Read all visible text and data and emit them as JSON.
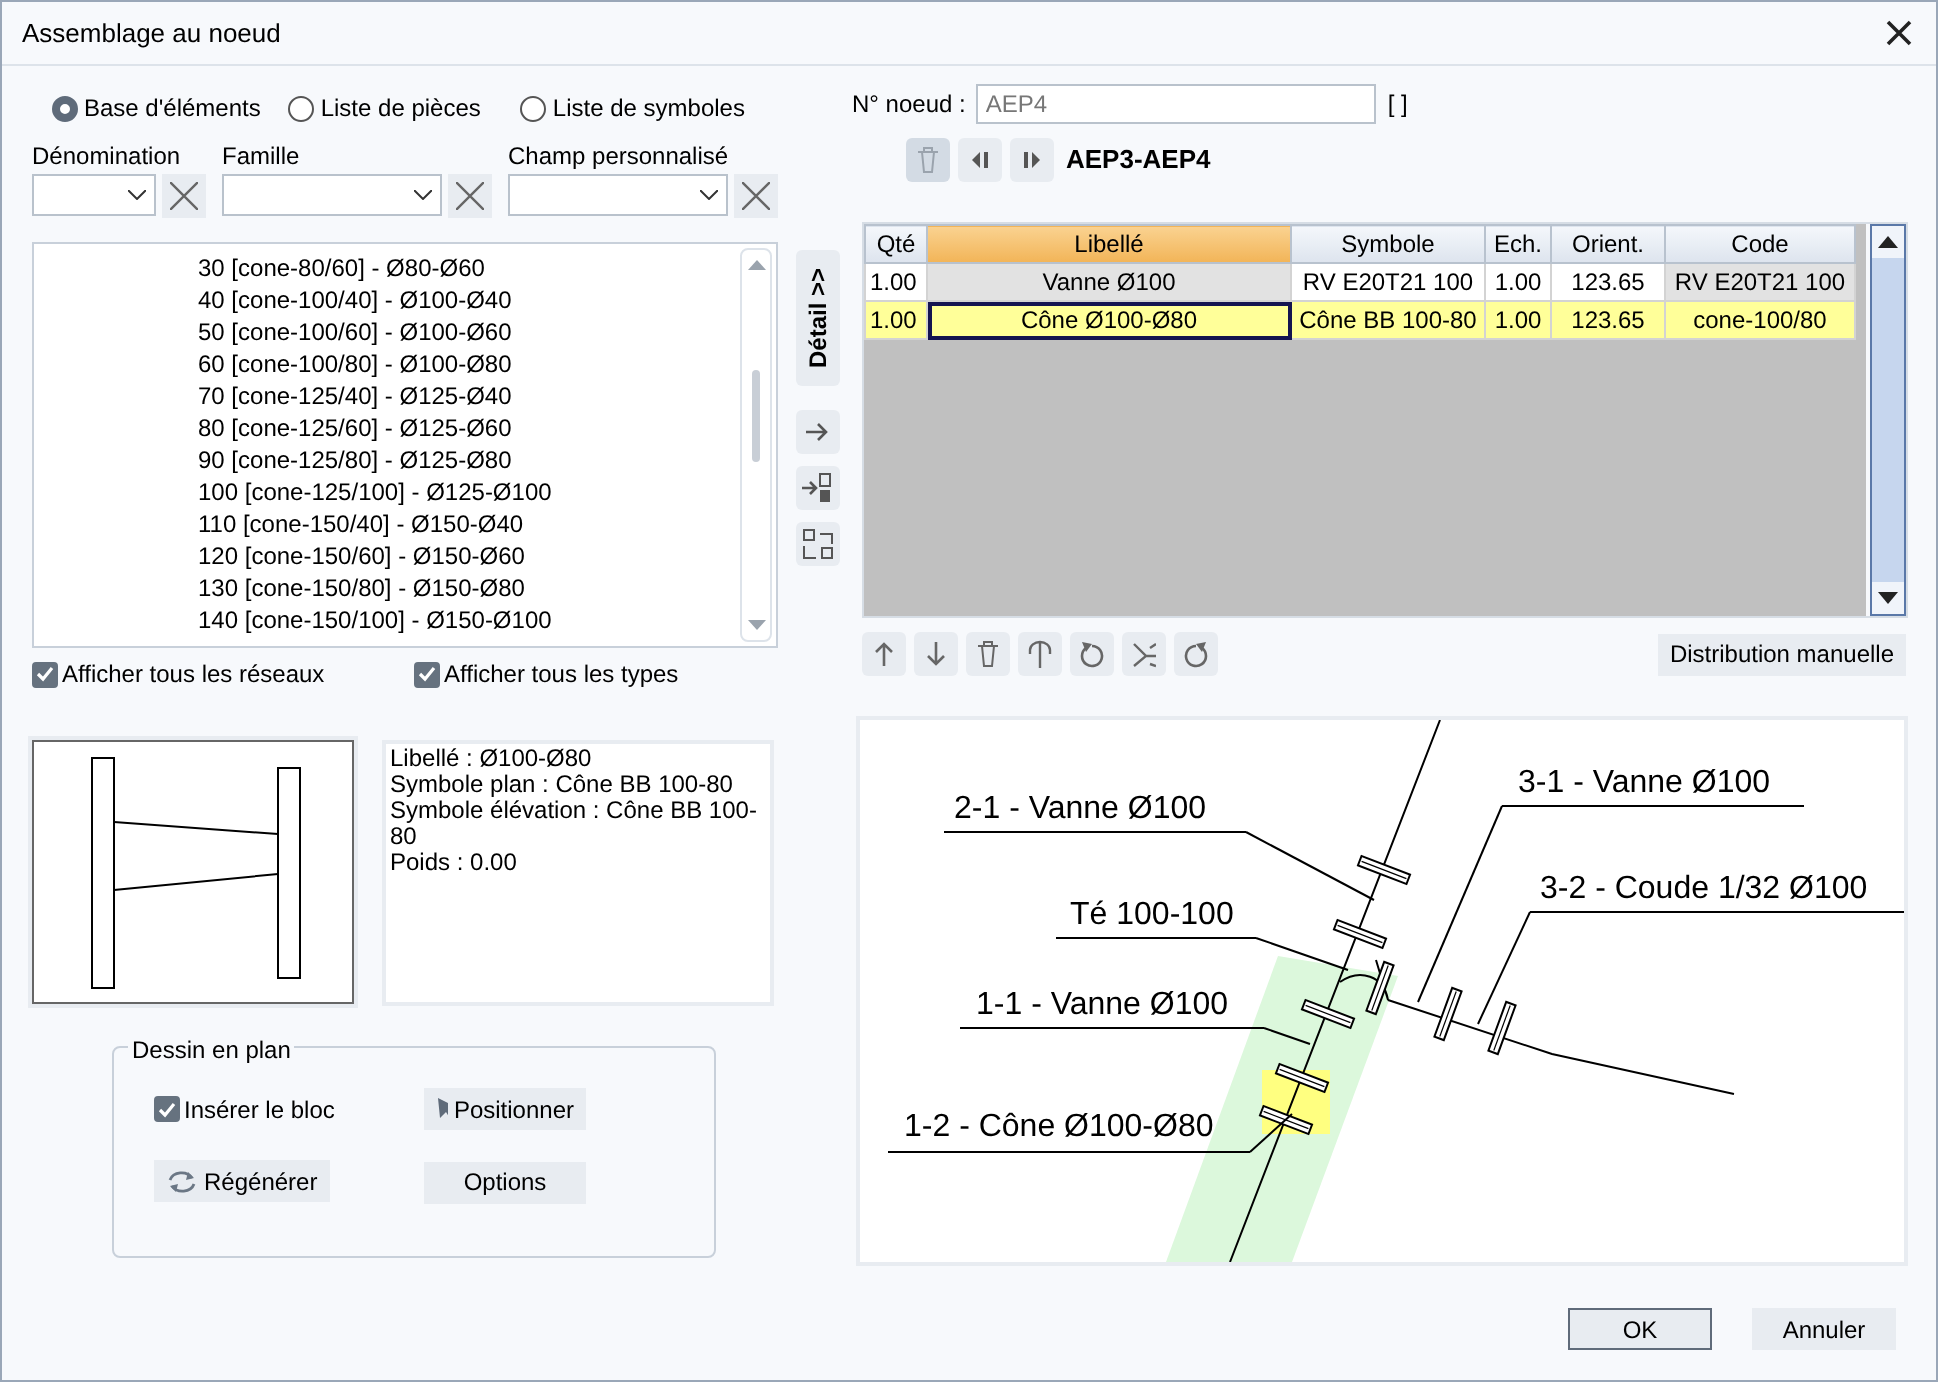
{
  "window": {
    "title": "Assemblage au noeud"
  },
  "source_options": [
    {
      "label": "Base d'éléments",
      "selected": true
    },
    {
      "label": "Liste de pièces",
      "selected": false
    },
    {
      "label": "Liste de symboles",
      "selected": false
    }
  ],
  "filters": [
    {
      "label": "Dénomination"
    },
    {
      "label": "Famille"
    },
    {
      "label": "Champ personnalisé"
    }
  ],
  "element_list": {
    "items": [
      "30 [cone-80/60] - Ø80-Ø60",
      "40 [cone-100/40] - Ø100-Ø40",
      "50 [cone-100/60] - Ø100-Ø60",
      "60 [cone-100/80] - Ø100-Ø80",
      "70 [cone-125/40] - Ø125-Ø40",
      "80 [cone-125/60] - Ø125-Ø60",
      "90 [cone-125/80] - Ø125-Ø80",
      "100 [cone-125/100] - Ø125-Ø100",
      "110 [cone-150/40] - Ø150-Ø40",
      "120 [cone-150/60] - Ø150-Ø60",
      "130 [cone-150/80] - Ø150-Ø80",
      "140 [cone-150/100] - Ø150-Ø100"
    ]
  },
  "checkboxes": [
    {
      "label": "Afficher tous les réseaux",
      "checked": true
    },
    {
      "label": "Afficher tous les types",
      "checked": true
    }
  ],
  "properties": [
    "Libellé : Ø100-Ø80",
    "Symbole plan : Cône BB 100-80",
    "Symbole élévation : Cône BB 100-80",
    "Poids : 0.00"
  ],
  "plan_drawing": {
    "title": "Dessin en plan",
    "insert_block": {
      "label": "Insérer le bloc",
      "checked": true
    },
    "buttons": [
      {
        "label": "Positionner",
        "kind": "position"
      },
      {
        "label": "Régénérer",
        "kind": "regenerate"
      },
      {
        "label": "Options",
        "kind": "plain"
      }
    ]
  },
  "detail_tab": {
    "label": "Détail >>"
  },
  "node": {
    "label": "N° noeud :",
    "value": "AEP4",
    "brackets": "[ ]"
  },
  "segment": {
    "title": "AEP3-AEP4"
  },
  "table": {
    "columns": [
      {
        "label": "Qté",
        "sorted": false,
        "shaded": false
      },
      {
        "label": "Libellé",
        "sorted": true,
        "shaded": true
      },
      {
        "label": "Symbole",
        "sorted": false,
        "shaded": false
      },
      {
        "label": "Ech.",
        "sorted": false,
        "shaded": false
      },
      {
        "label": "Orient.",
        "sorted": false,
        "shaded": false
      },
      {
        "label": "Code",
        "sorted": false,
        "shaded": true
      }
    ],
    "rows": [
      {
        "cells": [
          "1.00",
          "Vanne Ø100",
          "RV E20T21 100",
          "1.00",
          "123.65",
          "RV E20T21 100"
        ],
        "selected": false
      },
      {
        "cells": [
          "1.00",
          "Cône Ø100-Ø80",
          "Cône BB 100-80",
          "1.00",
          "123.65",
          "cone-100/80"
        ],
        "selected": true
      }
    ]
  },
  "manual_button": {
    "label": "Distribution manuelle"
  },
  "diagram": {
    "callouts": [
      {
        "label": "2-1 - Vanne Ø100"
      },
      {
        "label": "Té 100-100"
      },
      {
        "label": "1-1 - Vanne Ø100"
      },
      {
        "label": "1-2 - Cône Ø100-Ø80"
      },
      {
        "label": "3-1 - Vanne Ø100"
      },
      {
        "label": "3-2 - Coude 1/32 Ø100"
      }
    ]
  },
  "footer": {
    "buttons": [
      {
        "label": "OK",
        "default": true
      },
      {
        "label": "Annuler",
        "default": false
      }
    ]
  }
}
